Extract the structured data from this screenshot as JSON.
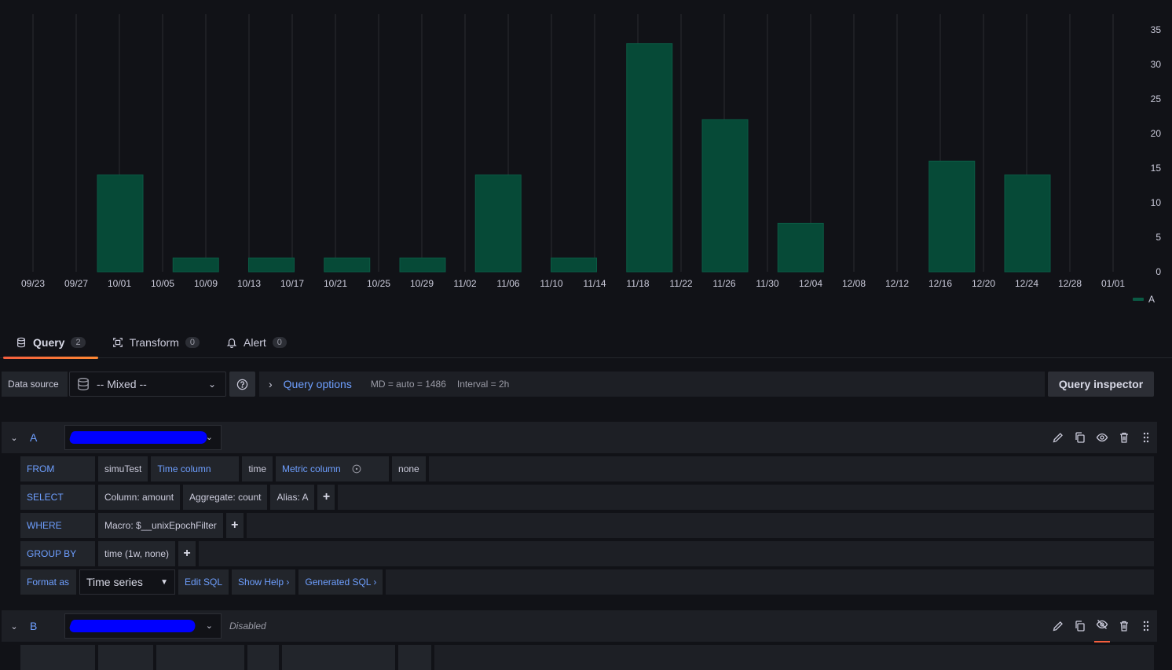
{
  "chart_data": {
    "type": "bar",
    "x_tick_labels": [
      "09/23",
      "09/27",
      "10/01",
      "10/05",
      "10/09",
      "10/13",
      "10/17",
      "10/21",
      "10/25",
      "10/29",
      "11/02",
      "11/06",
      "11/10",
      "11/14",
      "11/18",
      "11/22",
      "11/26",
      "11/30",
      "12/04",
      "12/08",
      "12/12",
      "12/16",
      "12/20",
      "12/24",
      "12/28",
      "01/01"
    ],
    "bars": [
      {
        "x": "10/01",
        "value": 14
      },
      {
        "x": "10/08",
        "value": 2
      },
      {
        "x": "10/15",
        "value": 2
      },
      {
        "x": "10/22",
        "value": 2
      },
      {
        "x": "10/29",
        "value": 2
      },
      {
        "x": "11/05",
        "value": 14
      },
      {
        "x": "11/12",
        "value": 2
      },
      {
        "x": "11/19",
        "value": 33
      },
      {
        "x": "11/26",
        "value": 22
      },
      {
        "x": "12/03",
        "value": 7
      },
      {
        "x": "12/17",
        "value": 16
      },
      {
        "x": "12/24",
        "value": 14
      }
    ],
    "y_ticks": [
      0,
      5,
      10,
      15,
      20,
      25,
      30,
      35
    ],
    "ylim": [
      0,
      35
    ],
    "series": [
      {
        "name": "A",
        "color": "#064a37"
      }
    ],
    "legend_position": "bottom-right",
    "grid": "vertical"
  },
  "legend": {
    "label": "A",
    "color": "#0b5a44"
  },
  "tabs": [
    {
      "label": "Query",
      "count": "2",
      "icon": "database-icon",
      "active": true
    },
    {
      "label": "Transform",
      "count": "0",
      "icon": "transform-icon",
      "active": false
    },
    {
      "label": "Alert",
      "count": "0",
      "icon": "bell-icon",
      "active": false
    }
  ],
  "datasource": {
    "label": "Data source",
    "value": "-- Mixed --",
    "help_icon": "help-icon",
    "query_options_label": "Query options",
    "md": "MD = auto = 1486",
    "interval": "Interval = 2h",
    "inspector_label": "Query inspector"
  },
  "queries": [
    {
      "name": "A",
      "from": {
        "kw": "FROM",
        "table": "simuTest",
        "time_col_label": "Time column",
        "time_col": "time",
        "metric_col_label": "Metric column",
        "metric_col": "none"
      },
      "select": {
        "kw": "SELECT",
        "column": "Column: amount",
        "aggregate": "Aggregate: count",
        "alias": "Alias: A"
      },
      "where": {
        "kw": "WHERE",
        "macro": "Macro: $__unixEpochFilter"
      },
      "group_by": {
        "kw": "GROUP BY",
        "value": "time (1w, none)"
      },
      "format": {
        "kw": "Format as",
        "value": "Time series",
        "edit_sql": "Edit SQL",
        "show_help": "Show Help ›",
        "generated_sql": "Generated SQL ›"
      }
    },
    {
      "name": "B",
      "status": "Disabled"
    }
  ],
  "plus": "+"
}
